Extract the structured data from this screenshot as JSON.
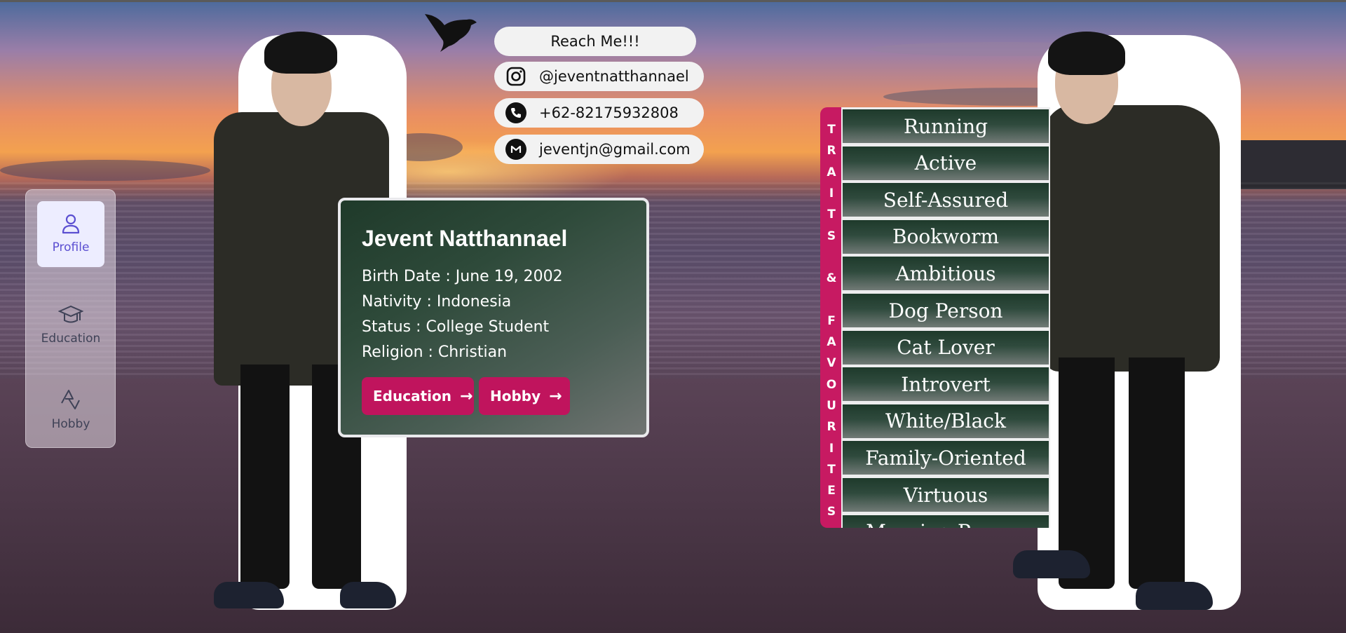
{
  "colors": {
    "accent": "#c0145d",
    "nav_active_bg": "#ededff",
    "nav_active_text": "#5b4fd1",
    "card_gradient_start": "#1f3a2a",
    "trait_bg": "#1e3a2b"
  },
  "sidebar": {
    "items": [
      {
        "label": "Profile",
        "icon": "user-icon",
        "active": true
      },
      {
        "label": "Education",
        "icon": "graduation-cap-icon",
        "active": false
      },
      {
        "label": "Hobby",
        "icon": "hobby-icon",
        "active": false
      }
    ]
  },
  "contact": {
    "title": "Reach Me!!!",
    "instagram": "@jeventnatthannael",
    "phone": "+62-82175932808",
    "email": "jeventjn@gmail.com"
  },
  "profile": {
    "name": "Jevent Natthannael",
    "birth": "Birth Date : June 19, 2002",
    "nativity": "Nativity : Indonesia",
    "status": "Status : College Student",
    "religion": "Religion : Christian",
    "btn_education": "Education",
    "btn_hobby": "Hobby"
  },
  "traits": {
    "tab_letters": [
      "T",
      "R",
      "A",
      "I",
      "T",
      "S",
      "",
      "&",
      "",
      "F",
      "A",
      "V",
      "O",
      "U",
      "R",
      "I",
      "T",
      "E",
      "S"
    ],
    "items": [
      "Running",
      "Active",
      "Self-Assured",
      "Bookworm",
      "Ambitious",
      "Dog Person",
      "Cat Lover",
      "Introvert",
      "White/Black",
      "Family-Oriented",
      "Virtuous",
      "Morning Person"
    ]
  }
}
